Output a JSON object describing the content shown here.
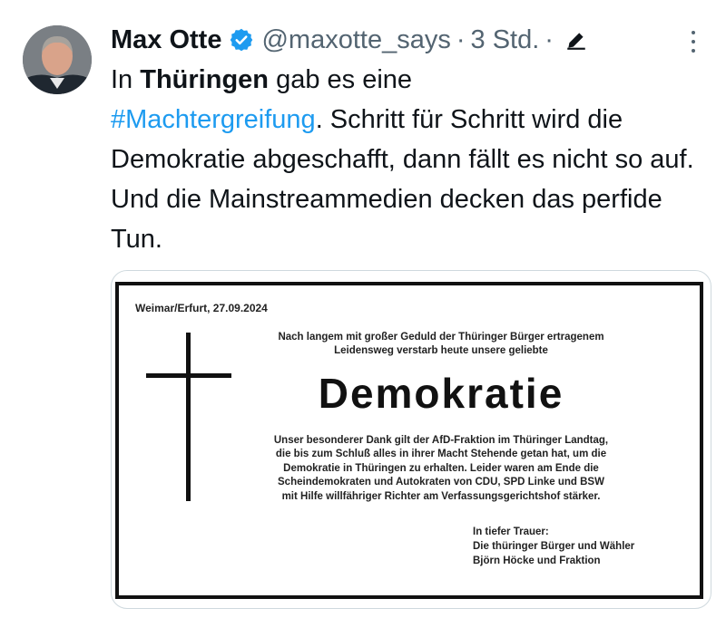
{
  "tweet": {
    "author_name": "Max Otte",
    "handle": "@maxotte_says",
    "time": "3 Std.",
    "separator": "·",
    "text_1": "In ",
    "text_bold": "Thüringen",
    "text_2": " gab es eine ",
    "hashtag": "#Machtergreifung",
    "text_3": ". Schritt für Schritt wird die Demokratie abgeschafft, dann fällt es nicht so auf. Und die Mainstreammedien decken das perfide Tun."
  },
  "image": {
    "place_date": "Weimar/Erfurt, 27.09.2024",
    "intro_line1": "Nach langem mit großer Geduld der Thüringer Bürger ertragenem",
    "intro_line2": "Leidensweg verstarb heute unsere geliebte",
    "title": "Demokratie",
    "thanks_line1": "Unser besonderer Dank gilt der AfD-Fraktion im Thüringer Landtag,",
    "thanks_line2": "die bis zum Schluß alles in ihrer Macht Stehende getan hat, um die",
    "thanks_line3": "Demokratie in Thüringen zu erhalten. Leider waren am Ende die",
    "thanks_line4": "Scheindemokraten und Autokraten von CDU, SPD Linke und BSW",
    "thanks_line5": "mit Hilfe willfähriger Richter am Verfassungsgerichtshof stärker.",
    "sign_line1": "In tiefer Trauer:",
    "sign_line2": "Die thüringer Bürger und Wähler",
    "sign_line3": "Björn Höcke und Fraktion"
  },
  "colors": {
    "hashtag": "#1d9bf0",
    "verified_badge": "#1d9bf0",
    "secondary_text": "#536471"
  }
}
